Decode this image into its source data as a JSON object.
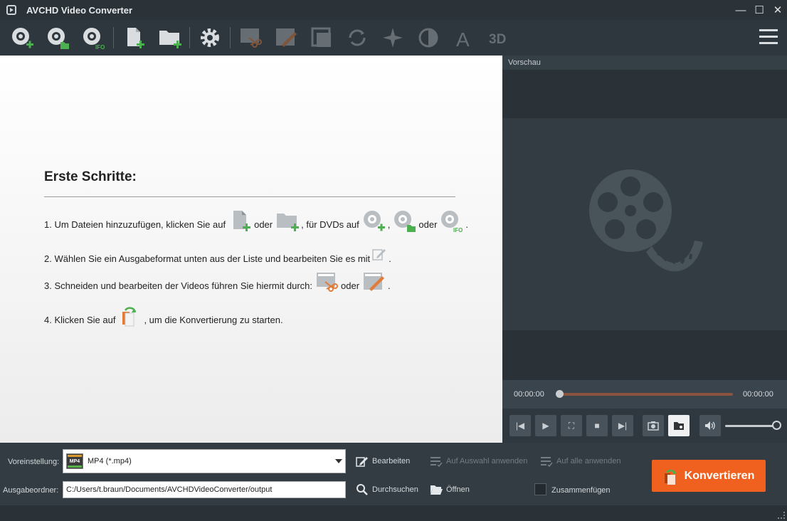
{
  "window": {
    "title": "AVCHD Video Converter",
    "minimize": "—",
    "maximize": "☐",
    "close": "✕"
  },
  "toolbar": {
    "items": [
      {
        "icon": "dvd-add-icon",
        "enabled": true
      },
      {
        "icon": "dvd-folder-icon",
        "enabled": true
      },
      {
        "icon": "dvd-ifo-icon",
        "enabled": true
      },
      {
        "icon": "add-file-icon",
        "enabled": true
      },
      {
        "icon": "add-folder-icon",
        "enabled": true
      },
      {
        "icon": "settings-gear-icon",
        "enabled": true
      },
      {
        "icon": "cut-icon",
        "enabled": false
      },
      {
        "icon": "edit-icon",
        "enabled": false
      },
      {
        "icon": "crop-icon",
        "enabled": false
      },
      {
        "icon": "rotate-icon",
        "enabled": false
      },
      {
        "icon": "effects-icon",
        "enabled": false
      },
      {
        "icon": "brightness-icon",
        "enabled": false
      },
      {
        "icon": "watermark-icon",
        "enabled": false
      },
      {
        "icon": "3d-icon",
        "enabled": false
      }
    ],
    "ifo_label": "IFO",
    "watermark_label": "A",
    "threed_label": "3D"
  },
  "getting_started": {
    "title": "Erste Schritte:",
    "step1_a": "1. Um Dateien hinzuzufügen, klicken Sie auf",
    "step1_b": "oder",
    "step1_c": ", für DVDs auf",
    "step1_d": ",",
    "step1_e": "oder",
    "step1_f": ".",
    "step2_a": "2. Wählen Sie ein Ausgabeformat unten aus der Liste und bearbeiten Sie es mit",
    "step2_b": ".",
    "step3_a": "3. Schneiden und bearbeiten der Videos führen Sie hiermit durch:",
    "step3_b": "oder",
    "step3_c": ".",
    "step4_a": "4. Klicken Sie auf",
    "step4_b": ", um die Konvertierung zu starten."
  },
  "preview": {
    "header": "Vorschau",
    "time_current": "00:00:00",
    "time_total": "00:00:00",
    "progress": 0,
    "volume": 1.0
  },
  "bottom": {
    "preset_label": "Voreinstellung:",
    "preset_value": "MP4 (*.mp4)",
    "preset_badge": "MP4",
    "output_label": "Ausgabeordner:",
    "output_value": "C:/Users/t.braun/Documents/AVCHDVideoConverter/output",
    "edit_label": "Bearbeiten",
    "apply_selected_label": "Auf Auswahl anwenden",
    "apply_all_label": "Auf alle anwenden",
    "browse_label": "Durchsuchen",
    "open_label": "Öffnen",
    "merge_label": "Zusammenfügen",
    "convert_label": "Konvertieren"
  },
  "colors": {
    "accent": "#f0611f",
    "green": "#4caf50",
    "dark": "#2e373e"
  }
}
